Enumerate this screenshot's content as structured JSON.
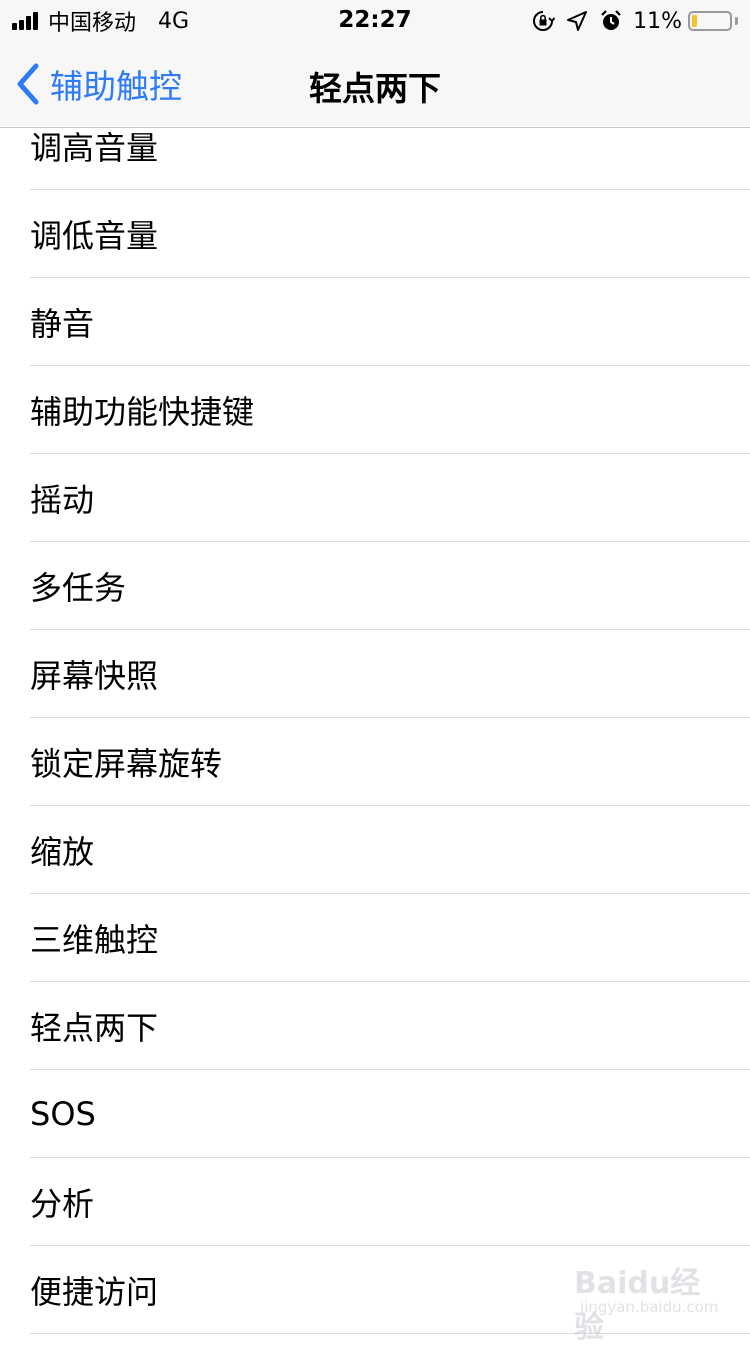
{
  "status_bar": {
    "carrier": "中国移动",
    "network": "4G",
    "time": "22:27",
    "battery_percent": "11%",
    "battery_color": "#f5c330"
  },
  "nav": {
    "back_label": "辅助触控",
    "title": "轻点两下",
    "accent_color": "#2f7bf5"
  },
  "list": {
    "items": [
      "调高音量",
      "调低音量",
      "静音",
      "辅助功能快捷键",
      "摇动",
      "多任务",
      "屏幕快照",
      "锁定屏幕旋转",
      "缩放",
      "三维触控",
      "轻点两下",
      "SOS",
      "分析",
      "便捷访问"
    ]
  },
  "watermark": {
    "main": "Baidu经验",
    "sub": "jingyan.baidu.com"
  }
}
